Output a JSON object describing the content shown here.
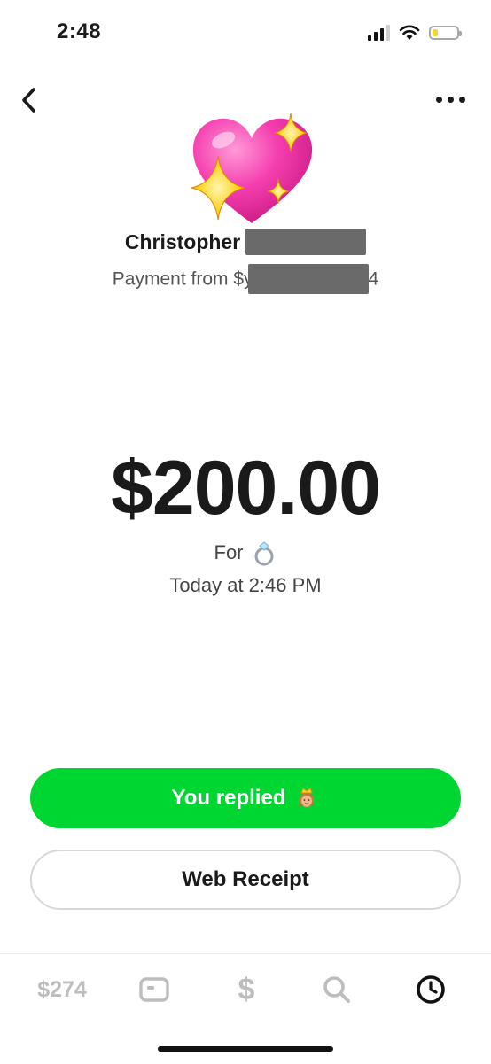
{
  "status_bar": {
    "time": "2:48",
    "icons": [
      "cellular-signal-icon",
      "wifi-icon",
      "battery-icon"
    ]
  },
  "nav": {
    "back_icon": "chevron-left-icon",
    "more_icon": "ellipsis-icon"
  },
  "header": {
    "avatar_emoji": "sparkling-heart",
    "name": "Christopher",
    "subtitle_prefix": "Payment from $y",
    "subtitle_suffix": "4"
  },
  "payment": {
    "amount": "$200.00",
    "for_label": "For",
    "for_emoji": "💍",
    "date": "Today at 2:46 PM"
  },
  "actions": {
    "replied_label": "You replied",
    "replied_emoji": "👸",
    "receipt_label": "Web Receipt"
  },
  "tabbar": {
    "balance": "$274",
    "pay_symbol": "$",
    "icons": [
      "card-icon",
      "dollar-icon",
      "search-icon",
      "clock-icon"
    ]
  },
  "colors": {
    "accent_green": "#00d632",
    "text_dark": "#1a1a1a",
    "tab_inactive": "#bdbdbd"
  }
}
